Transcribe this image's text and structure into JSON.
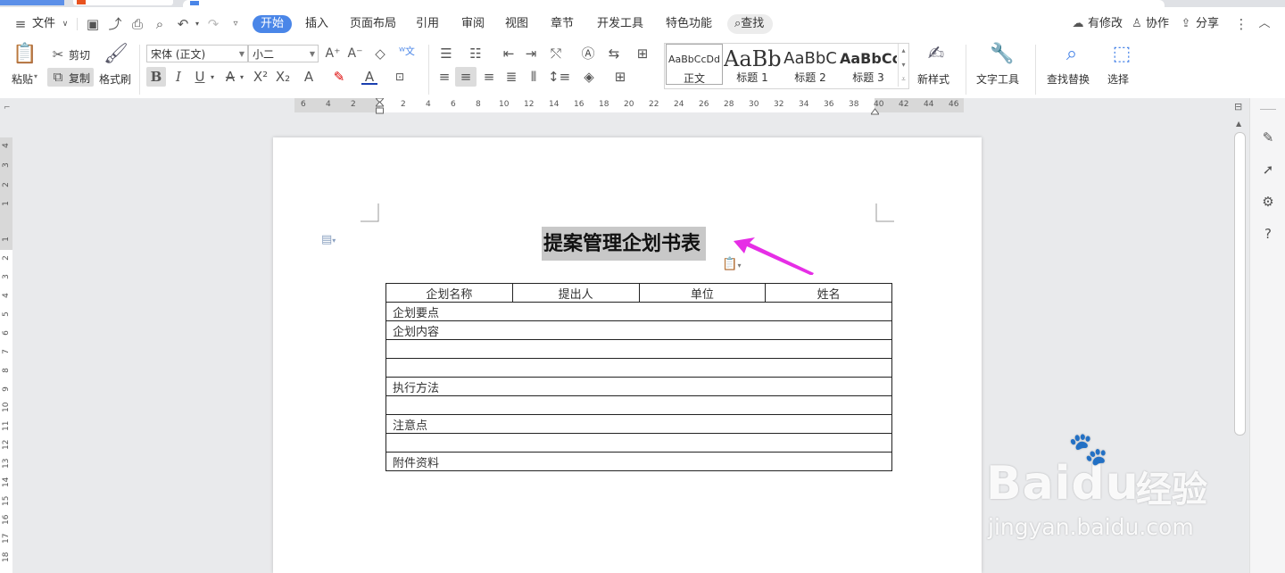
{
  "menubar": {
    "file": "文件",
    "tabs": [
      "开始",
      "插入",
      "页面布局",
      "引用",
      "审阅",
      "视图",
      "章节",
      "开发工具",
      "特色功能"
    ],
    "search": "查找",
    "right": {
      "modified": "有修改",
      "collaborate": "协作",
      "share": "分享"
    }
  },
  "ribbon": {
    "paste": "粘贴",
    "cut": "剪切",
    "copy": "复制",
    "format_painter": "格式刷",
    "font_name": "宋体 (正文)",
    "font_size": "小二",
    "styles": [
      {
        "preview": "AaBbCcDd",
        "label": "正文"
      },
      {
        "preview": "AaBb",
        "label": "标题 1"
      },
      {
        "preview": "AaBbC",
        "label": "标题 2"
      },
      {
        "preview": "AaBbCc",
        "label": "标题 3"
      }
    ],
    "new_style": "新样式",
    "text_tools": "文字工具",
    "find_replace": "查找替换",
    "select": "选择"
  },
  "ruler": {
    "h_left": [
      "6",
      "4",
      "2"
    ],
    "h_right": [
      "2",
      "4",
      "6",
      "8",
      "10",
      "12",
      "14",
      "16",
      "18",
      "20",
      "22",
      "24",
      "26",
      "28",
      "30",
      "32",
      "34",
      "36",
      "38",
      "40",
      "42",
      "44",
      "46"
    ],
    "v_top": [
      "4",
      "3",
      "2",
      "1"
    ],
    "v_body": [
      "1",
      "2",
      "3",
      "4",
      "5",
      "6",
      "7",
      "8",
      "9",
      "10",
      "11",
      "12",
      "13",
      "14",
      "15",
      "16",
      "17",
      "18"
    ]
  },
  "document": {
    "title": "提案管理企划书表",
    "table_header": [
      "企划名称",
      "提出人",
      "单位",
      "姓名"
    ],
    "table_rows": [
      "企划要点",
      "企划内容",
      "",
      "",
      "执行方法",
      "",
      "注意点",
      "",
      "附件资料"
    ]
  },
  "annotation": {
    "arrow_color": "#e62ee6"
  },
  "watermark": {
    "brand": "Baidu",
    "product": "经验",
    "url": "jingyan.baidu.com"
  }
}
